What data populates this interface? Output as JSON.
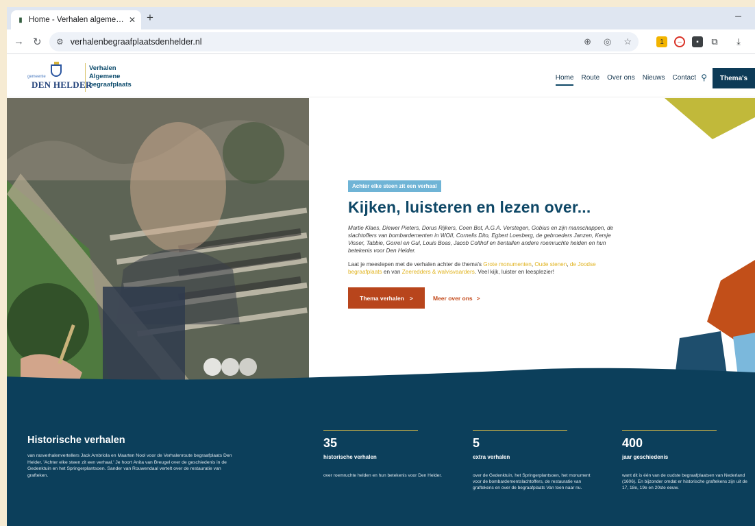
{
  "browser": {
    "tab_title": "Home - Verhalen algemene be",
    "tab_close": "✕",
    "new_tab": "+",
    "minimize": "–",
    "url": "verhalenbegraafplaatsdenhelder.nl",
    "ext_badge": "1"
  },
  "site": {
    "logo_small": "gemeente",
    "logo_text": "DEN HELDER",
    "brand_line1": "Verhalen",
    "brand_line2": "Algemene",
    "brand_line3": "begraafplaats",
    "nav": [
      "Home",
      "Route",
      "Over ons",
      "Nieuws",
      "Contact"
    ],
    "themas_label": "Thema's"
  },
  "hero": {
    "kicker": "Achter elke steen zit een verhaal",
    "title": "Kijken, luisteren en lezen over...",
    "para1": "Martie Klaes, Diewer Pieters, Dorus Rijkers, Coen Bot, A.G.A. Verstegen, Gobius en zijn manschappen, de slachtoffers van bombardementen in WOII, Cornelis Dito, Egbert Loesberg, de gebroeders Janzen, Kersje Visser, Tabbie, Gorrel en Gul, Louis Boas, Jacob Colthof en tientallen andere roemruchte helden en hun betekenis voor Den Helder.",
    "para2_a": "Laat je meeslepen met de verhalen achter de thema's ",
    "para2_link1": "Grote monumenten",
    "para2_b": ", ",
    "para2_link2": "Oude stenen",
    "para2_c": ", ",
    "para2_link3": "de Joodse begraafplaats",
    "para2_d": " en van ",
    "para2_link4": "Zeeredders & walvisvaarders",
    "para2_e": ". Veel kijk, luister en leesplezier!",
    "btn_primary": "Thema verhalen",
    "btn_secondary": "Meer over ons",
    "chevron": ">"
  },
  "stats": {
    "intro_title": "Historische verhalen",
    "intro_text": "van rasverhalenvertellers Jack Ambriola en Maarten Nool voor de Verhalenroute begraafplaats Den Helder. 'Achter elke steen zit een verhaal.' Je hoort Anita van Breugel over de geschiedenis in de Gedenktuin en het Springerplantsoen. Sander van Rouwendaal vertelt over de restauratie van grafteken.",
    "items": [
      {
        "number": "35",
        "label": "historische verhalen",
        "desc": "over roemruchte helden en hun betekenis voor Den Helder."
      },
      {
        "number": "5",
        "label": "extra verhalen",
        "desc": "over de Gedenktuin, het Springerplantsoen, het monument voor de bombardementslachtoffers, de restauratie van graftekens en over de begraafplaats Van toen naar nu."
      },
      {
        "number": "400",
        "label": "jaar geschiedenis",
        "desc": "want dit is één van de oudste begraafplaatsen van Nederland (1606). En bijzonder omdat er historische graftekens zijn uit de 17, 18e, 19e en 20ste eeuw."
      }
    ]
  },
  "colors": {
    "navy": "#0c3f5b",
    "orange": "#b8451c",
    "yellow": "#e0b21c",
    "sky": "#6fb4d6"
  }
}
